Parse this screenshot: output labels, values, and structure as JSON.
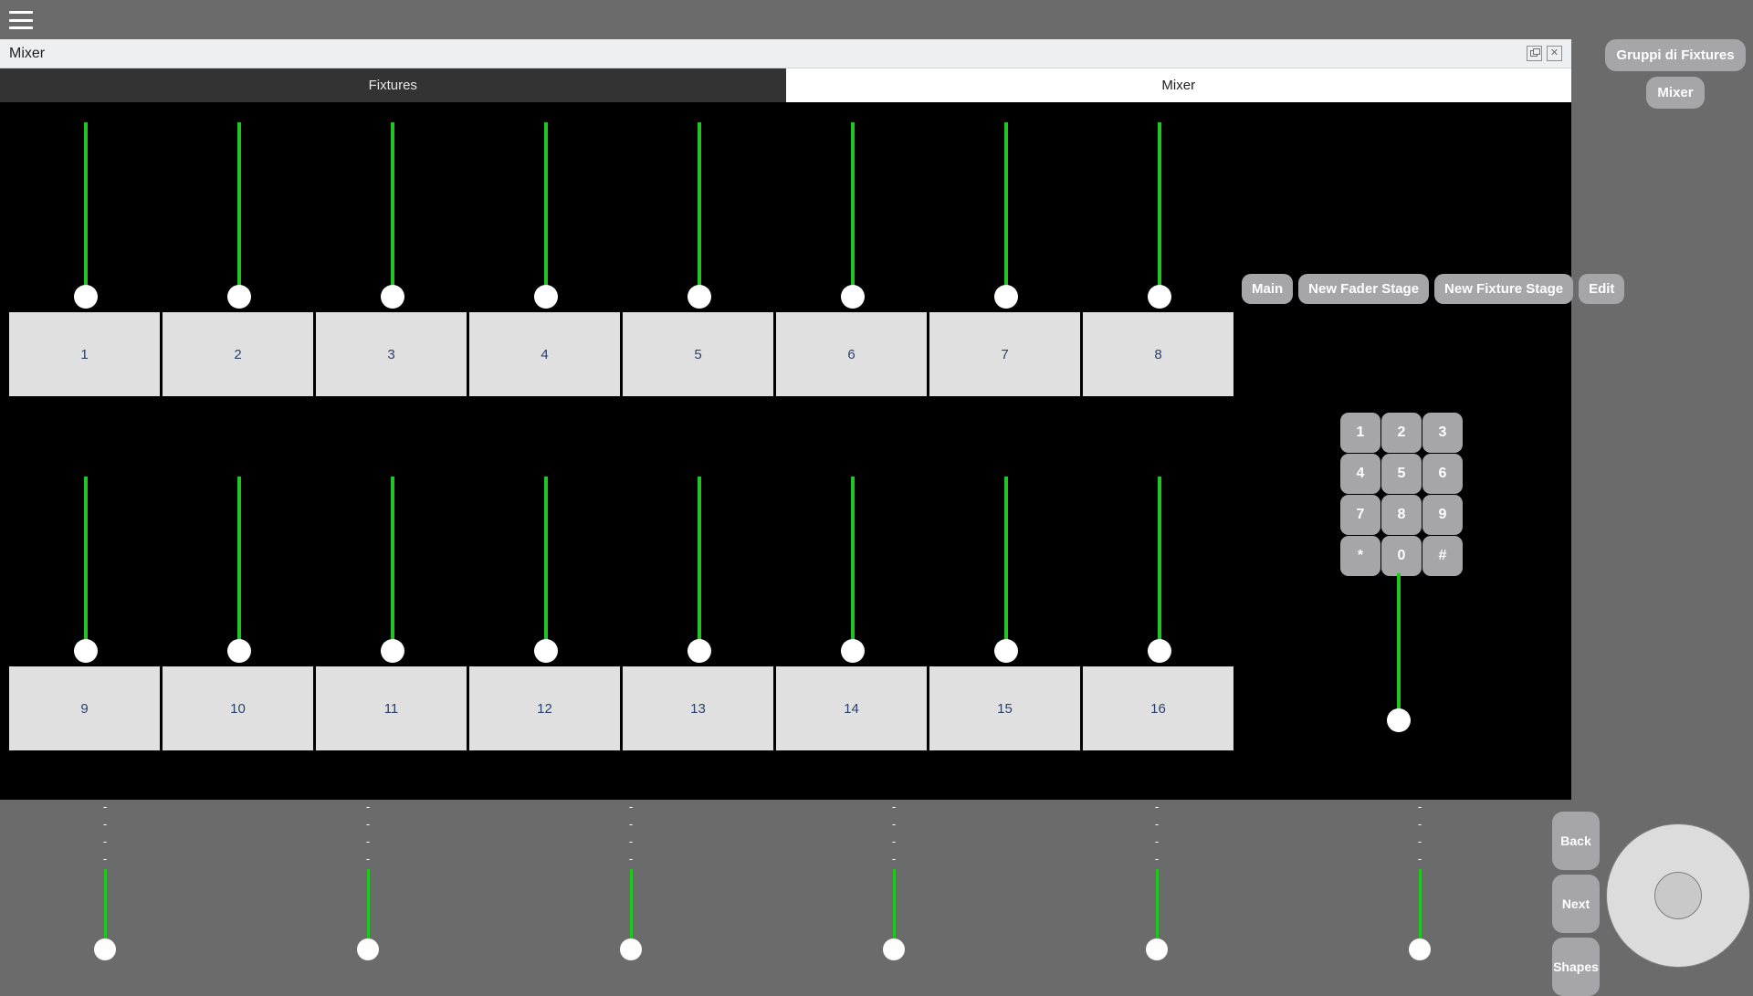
{
  "app_bar": {
    "menu_icon": "hamburger-menu-icon"
  },
  "window": {
    "title": "Mixer",
    "restore_icon": "restore-window-icon",
    "close_icon": "close-window-icon",
    "close_glyph": "✕"
  },
  "tabs": [
    {
      "label": "Fixtures",
      "active": false
    },
    {
      "label": "Mixer",
      "active": true
    }
  ],
  "fader_banks": [
    {
      "id": "top",
      "fixtures": [
        "1",
        "2",
        "3",
        "4",
        "5",
        "6",
        "7",
        "8"
      ]
    },
    {
      "id": "bottom",
      "fixtures": [
        "9",
        "10",
        "11",
        "12",
        "13",
        "14",
        "15",
        "16"
      ]
    }
  ],
  "stage_toolbar": [
    {
      "label": "Main"
    },
    {
      "label": "New Fader Stage"
    },
    {
      "label": "New Fixture Stage"
    },
    {
      "label": "Edit"
    }
  ],
  "keypad": [
    "1",
    "2",
    "3",
    "4",
    "5",
    "6",
    "7",
    "8",
    "9",
    "*",
    "0",
    "#"
  ],
  "master_fader": {
    "name": "master-fader"
  },
  "bottom_faders": [
    {
      "labels": [
        "-",
        "-",
        "-",
        "-"
      ]
    },
    {
      "labels": [
        "-",
        "-",
        "-",
        "-"
      ]
    },
    {
      "labels": [
        "-",
        "-",
        "-",
        "-"
      ]
    },
    {
      "labels": [
        "-",
        "-",
        "-",
        "-"
      ]
    },
    {
      "labels": [
        "-",
        "-",
        "-",
        "-"
      ]
    },
    {
      "labels": [
        "-",
        "-",
        "-",
        "-"
      ]
    }
  ],
  "bottom_actions": [
    {
      "label": "Back"
    },
    {
      "label": "Next"
    },
    {
      "label": "Shapes"
    }
  ],
  "jog_wheel": {
    "name": "jog-wheel"
  },
  "sidebar": [
    {
      "label": "Gruppi di Fixtures"
    },
    {
      "label": "Mixer"
    }
  ],
  "colors": {
    "fader_green": "#21c521",
    "panel_gray": "#6b6b6b",
    "button_gray": "#a6a6a9",
    "stage_black": "#000000",
    "fixture_button": "#e0e0e0",
    "fixture_label": "#2a3f6b",
    "titlebar": "#eeeff1",
    "tab_inactive": "#333333"
  }
}
